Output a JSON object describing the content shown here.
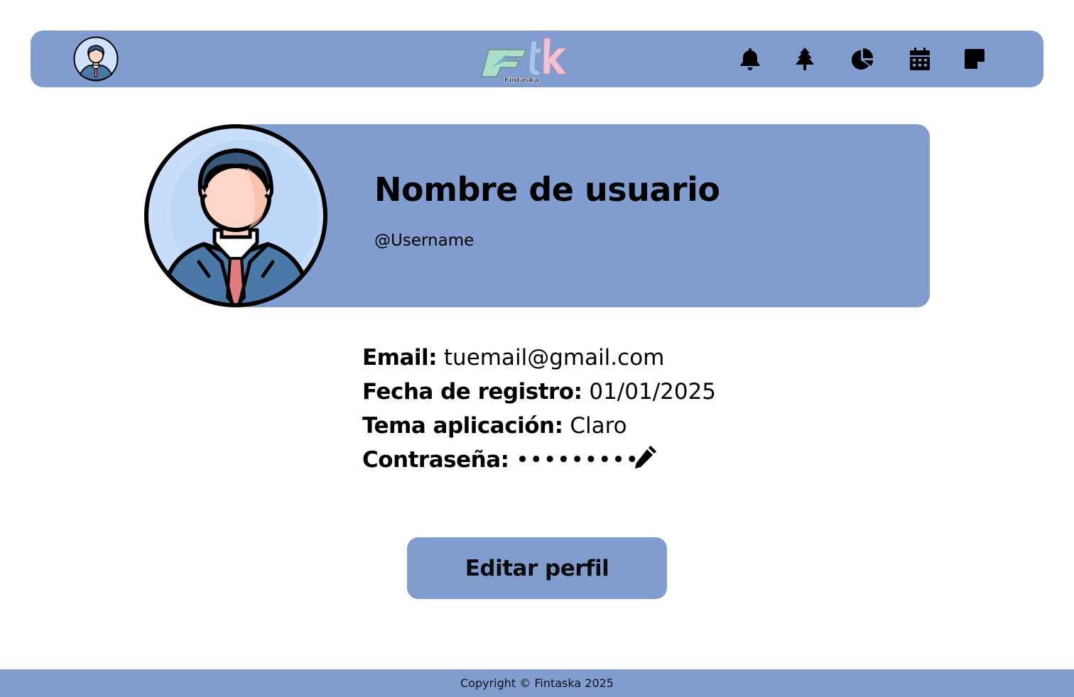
{
  "app": {
    "logo_text": "Ftk",
    "logo_subtext": "Fintaska"
  },
  "header": {
    "nav_icons": [
      "bell-icon",
      "tree-icon",
      "pie-chart-icon",
      "calendar-icon",
      "sticky-note-icon"
    ]
  },
  "profile": {
    "display_name": "Nombre de usuario",
    "username": "@Username"
  },
  "info": {
    "email_label": "Email:",
    "email_value": "tuemail@gmail.com",
    "registration_label": "Fecha de registro:",
    "registration_value": "01/01/2025",
    "theme_label": "Tema aplicación:",
    "theme_value": "Claro",
    "password_label": "Contraseña:",
    "password_value": "•••••••••"
  },
  "actions": {
    "edit_profile_label": "Editar perfil"
  },
  "footer": {
    "copyright": "Copyright © Fintaska 2025"
  },
  "colors": {
    "accent": "#819dcf",
    "background": "#ffffff"
  }
}
